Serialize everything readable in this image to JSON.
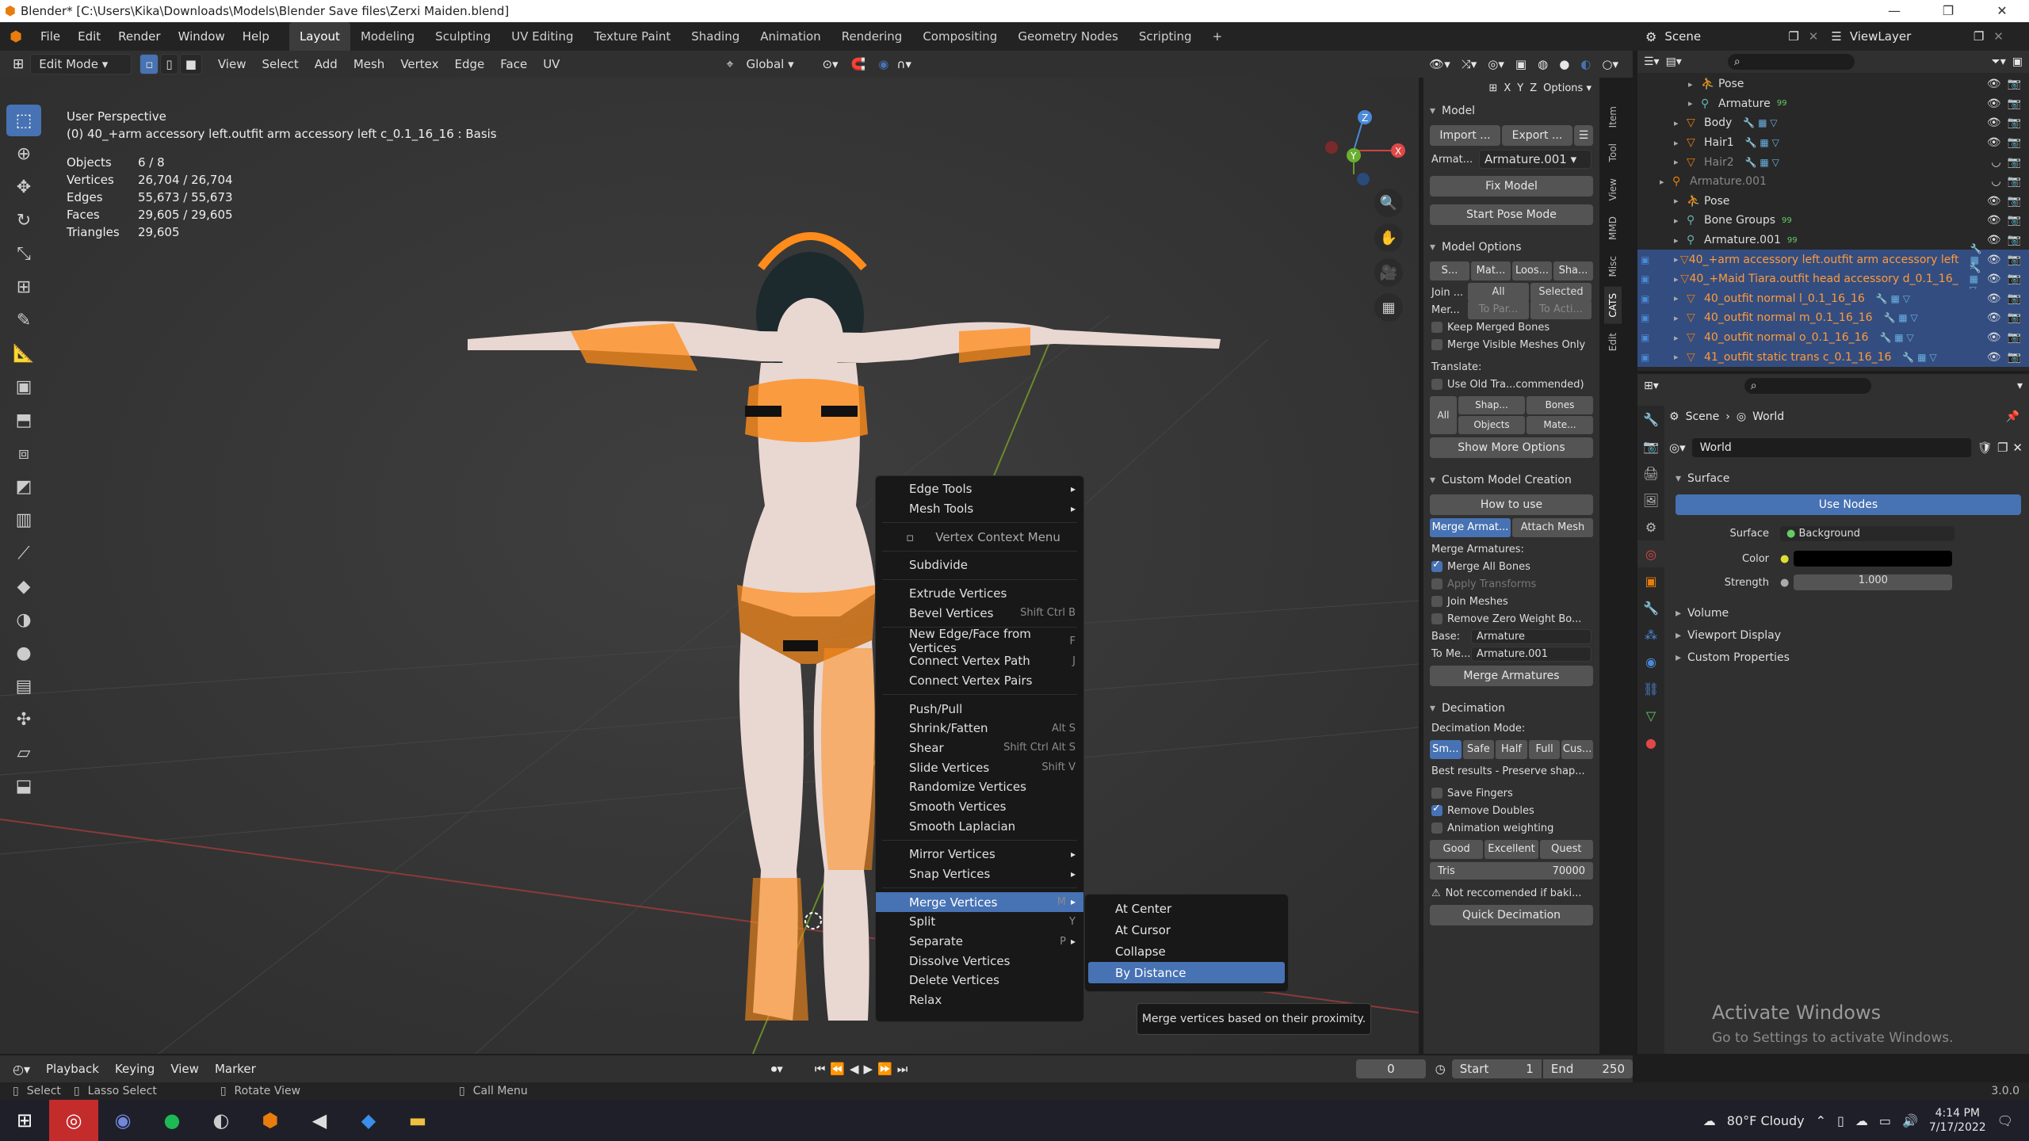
{
  "window": {
    "title": "Blender* [C:\\Users\\Kika\\Downloads\\Models\\Blender Save files\\Zerxi Maiden.blend]"
  },
  "menu": [
    "File",
    "Edit",
    "Render",
    "Window",
    "Help"
  ],
  "workspaces": [
    "Layout",
    "Modeling",
    "Sculpting",
    "UV Editing",
    "Texture Paint",
    "Shading",
    "Animation",
    "Rendering",
    "Compositing",
    "Geometry Nodes",
    "Scripting",
    "+"
  ],
  "scene": {
    "name": "Scene",
    "viewlayer": "ViewLayer"
  },
  "header3d": {
    "mode": "Edit Mode",
    "menus": [
      "View",
      "Select",
      "Add",
      "Mesh",
      "Vertex",
      "Edge",
      "Face",
      "UV"
    ],
    "orientation": "Global",
    "options": "Options",
    "axes": [
      "X",
      "Y",
      "Z"
    ]
  },
  "viewport": {
    "perspective": "User Perspective",
    "object_line": "(0) 40_+arm accessory left.outfit arm accessory left c_0.1_16_16 : Basis",
    "stats": [
      {
        "k": "Objects",
        "v": "6 / 8"
      },
      {
        "k": "Vertices",
        "v": "26,704 / 26,704"
      },
      {
        "k": "Edges",
        "v": "55,673 / 55,673"
      },
      {
        "k": "Faces",
        "v": "29,605 / 29,605"
      },
      {
        "k": "Triangles",
        "v": "29,605"
      }
    ]
  },
  "context_menu": {
    "items": [
      {
        "label": "Edge Tools",
        "sub": true
      },
      {
        "label": "Mesh Tools",
        "sub": true
      },
      {
        "sep": true
      },
      {
        "label": "Vertex Context Menu",
        "title": true
      },
      {
        "sep": true
      },
      {
        "label": "Subdivide"
      },
      {
        "sep": true
      },
      {
        "label": "Extrude Vertices"
      },
      {
        "label": "Bevel Vertices",
        "sc": "Shift Ctrl B"
      },
      {
        "sep": true
      },
      {
        "label": "New Edge/Face from Vertices",
        "sc": "F"
      },
      {
        "label": "Connect Vertex Path",
        "sc": "J"
      },
      {
        "label": "Connect Vertex Pairs"
      },
      {
        "sep": true
      },
      {
        "label": "Push/Pull"
      },
      {
        "label": "Shrink/Fatten",
        "sc": "Alt S"
      },
      {
        "label": "Shear",
        "sc": "Shift Ctrl Alt S"
      },
      {
        "label": "Slide Vertices",
        "sc": "Shift V"
      },
      {
        "label": "Randomize Vertices"
      },
      {
        "label": "Smooth Vertices"
      },
      {
        "label": "Smooth Laplacian"
      },
      {
        "sep": true
      },
      {
        "label": "Mirror Vertices",
        "sub": true
      },
      {
        "label": "Snap Vertices",
        "sub": true
      },
      {
        "sep": true
      },
      {
        "label": "Merge Vertices",
        "sc": "M",
        "sub": true,
        "hl": true
      },
      {
        "label": "Split",
        "sc": "Y"
      },
      {
        "label": "Separate",
        "sc": "P",
        "sub": true
      },
      {
        "label": "Dissolve Vertices"
      },
      {
        "label": "Delete Vertices"
      },
      {
        "label": "Relax"
      }
    ]
  },
  "merge_submenu": {
    "items": [
      "At Center",
      "At Cursor",
      "Collapse",
      "By Distance"
    ],
    "selected": "By Distance"
  },
  "tooltip": "Merge vertices based on their proximity.",
  "npanel": {
    "tabs": [
      "Item",
      "Tool",
      "View",
      "MMD",
      "Misc",
      "CATS",
      "Edit"
    ],
    "model": {
      "title": "Model",
      "import": "Import ...",
      "export": "Export ...",
      "armature_label": "Armat...",
      "armature": "Armature.001",
      "fix": "Fix Model",
      "pose": "Start Pose Mode"
    },
    "model_options": {
      "title": "Model Options",
      "row1": [
        "S...",
        "Mat...",
        "Loos...",
        "Sha..."
      ],
      "join": "Join ...",
      "join_opts": [
        "All",
        "Selected"
      ],
      "merge": "Mer...",
      "merge_opts": [
        "To Par...",
        "To Acti..."
      ],
      "keep": "Keep Merged Bones",
      "visible": "Merge Visible Meshes Only",
      "translate": "Translate:",
      "old": "Use Old Tra...commended)",
      "all": "All",
      "shap": "Shap...",
      "bones": "Bones",
      "objects": "Objects",
      "mate": "Mate...",
      "more": "Show More Options"
    },
    "custom": {
      "title": "Custom Model Creation",
      "how": "How to use",
      "tabs": [
        "Merge Armat...",
        "Attach Mesh"
      ],
      "merge_label": "Merge Armatures:",
      "all_bones": "Merge All Bones",
      "apply": "Apply Transforms",
      "join": "Join Meshes",
      "remove": "Remove Zero Weight Bo...",
      "base_label": "Base:",
      "base": "Armature",
      "to_label": "To Me...",
      "to": "Armature.001",
      "btn": "Merge Armatures"
    },
    "decimation": {
      "title": "Decimation",
      "mode_label": "Decimation Mode:",
      "modes": [
        "Sm...",
        "Safe",
        "Half",
        "Full",
        "Cus..."
      ],
      "desc": "Best results - Preserve shap...",
      "fingers": "Save Fingers",
      "doubles": "Remove Doubles",
      "anim": "Animation weighting",
      "quality": [
        "Good",
        "Excellent",
        "Quest"
      ],
      "tris_label": "Tris",
      "tris": "70000",
      "warn": "Not reccomended if baki...",
      "quick": "Quick Decimation"
    }
  },
  "outliner": {
    "rows": [
      {
        "name": "Pose",
        "indent": 3,
        "dim": false,
        "icon": "pose"
      },
      {
        "name": "Armature",
        "indent": 3,
        "dim": false,
        "icon": "armature",
        "extra": "99"
      },
      {
        "name": "Body",
        "indent": 2,
        "dim": false,
        "icon": "mesh"
      },
      {
        "name": "Hair1",
        "indent": 2,
        "dim": false,
        "icon": "mesh"
      },
      {
        "name": "Hair2",
        "indent": 2,
        "dim": true,
        "icon": "mesh"
      },
      {
        "name": "Armature.001",
        "indent": 1,
        "dim": true,
        "icon": "armobj"
      },
      {
        "name": "Pose",
        "indent": 2,
        "dim": false,
        "icon": "pose"
      },
      {
        "name": "Bone Groups",
        "indent": 2,
        "dim": false,
        "icon": "bones",
        "extra": "99"
      },
      {
        "name": "Armature.001",
        "indent": 2,
        "dim": false,
        "icon": "armature",
        "extra": "99"
      },
      {
        "name": "40_+arm accessory left.outfit arm accessory left",
        "indent": 2,
        "sel": true,
        "orange": true,
        "icon": "mesh"
      },
      {
        "name": "40_+Maid Tiara.outfit head accessory d_0.1_16_",
        "indent": 2,
        "sel": true,
        "orange": true,
        "icon": "mesh"
      },
      {
        "name": "40_outfit normal l_0.1_16_16",
        "indent": 2,
        "sel": true,
        "orange": true,
        "icon": "mesh"
      },
      {
        "name": "40_outfit normal m_0.1_16_16",
        "indent": 2,
        "sel": true,
        "orange": true,
        "icon": "mesh"
      },
      {
        "name": "40_outfit normal o_0.1_16_16",
        "indent": 2,
        "sel": true,
        "orange": true,
        "icon": "mesh"
      },
      {
        "name": "41_outfit static trans c_0.1_16_16",
        "indent": 2,
        "sel": true,
        "orange": true,
        "icon": "mesh"
      }
    ]
  },
  "properties": {
    "breadcrumb": [
      "Scene",
      "World"
    ],
    "world": "World",
    "surface": "Surface",
    "use_nodes": "Use Nodes",
    "surface_label": "Surface",
    "surface_val": "Background",
    "color_label": "Color",
    "strength_label": "Strength",
    "strength": "1.000",
    "sections": [
      "Volume",
      "Viewport Display",
      "Custom Properties"
    ]
  },
  "timeline": {
    "menus": [
      "Playback",
      "Keying",
      "View",
      "Marker"
    ],
    "frame": "0",
    "start_label": "Start",
    "start": "1",
    "end_label": "End",
    "end": "250"
  },
  "statusbar": {
    "select": "Select",
    "lasso": "Lasso Select",
    "rotate": "Rotate View",
    "call": "Call Menu",
    "version": "3.0.0"
  },
  "watermark": {
    "title": "Activate Windows",
    "sub": "Go to Settings to activate Windows."
  },
  "taskbar": {
    "weather": "80°F  Cloudy",
    "time": "4:14 PM",
    "date": "7/17/2022"
  },
  "colors": {
    "accent": "#4772b3",
    "selection": "#ff8c1a",
    "bg": "#393939"
  }
}
